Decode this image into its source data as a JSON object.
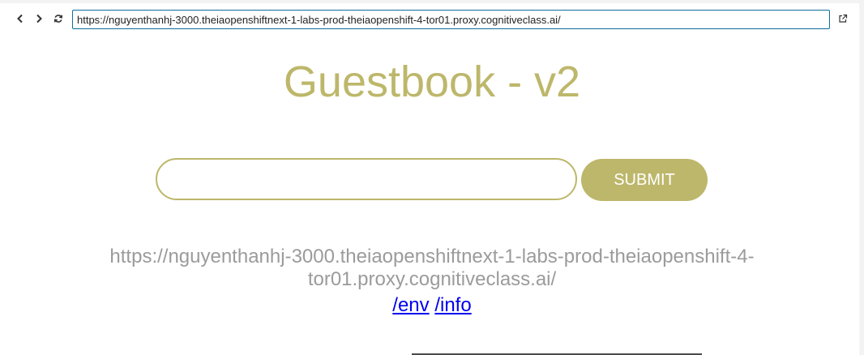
{
  "browser": {
    "url": "https://nguyenthanhj-3000.theiaopenshiftnext-1-labs-prod-theiaopenshift-4-tor01.proxy.cognitiveclass.ai/",
    "icons": {
      "back": "chevron-left-icon",
      "forward": "chevron-right-icon",
      "reload": "refresh-icon",
      "external": "external-link-icon"
    }
  },
  "page": {
    "title": "Guestbook - v2",
    "entry_value": "",
    "submit_label": "SUBMIT",
    "host_address": "https://nguyenthanhj-3000.theiaopenshiftnext-1-labs-prod-theiaopenshift-4-tor01.proxy.cognitiveclass.ai/",
    "links": [
      {
        "label": "/env"
      },
      {
        "label": "/info"
      }
    ]
  },
  "colors": {
    "accent": "#bdb76b",
    "muted_text": "#9b9b9b",
    "link": "#0000ee",
    "url_border": "#0e6e9c"
  }
}
